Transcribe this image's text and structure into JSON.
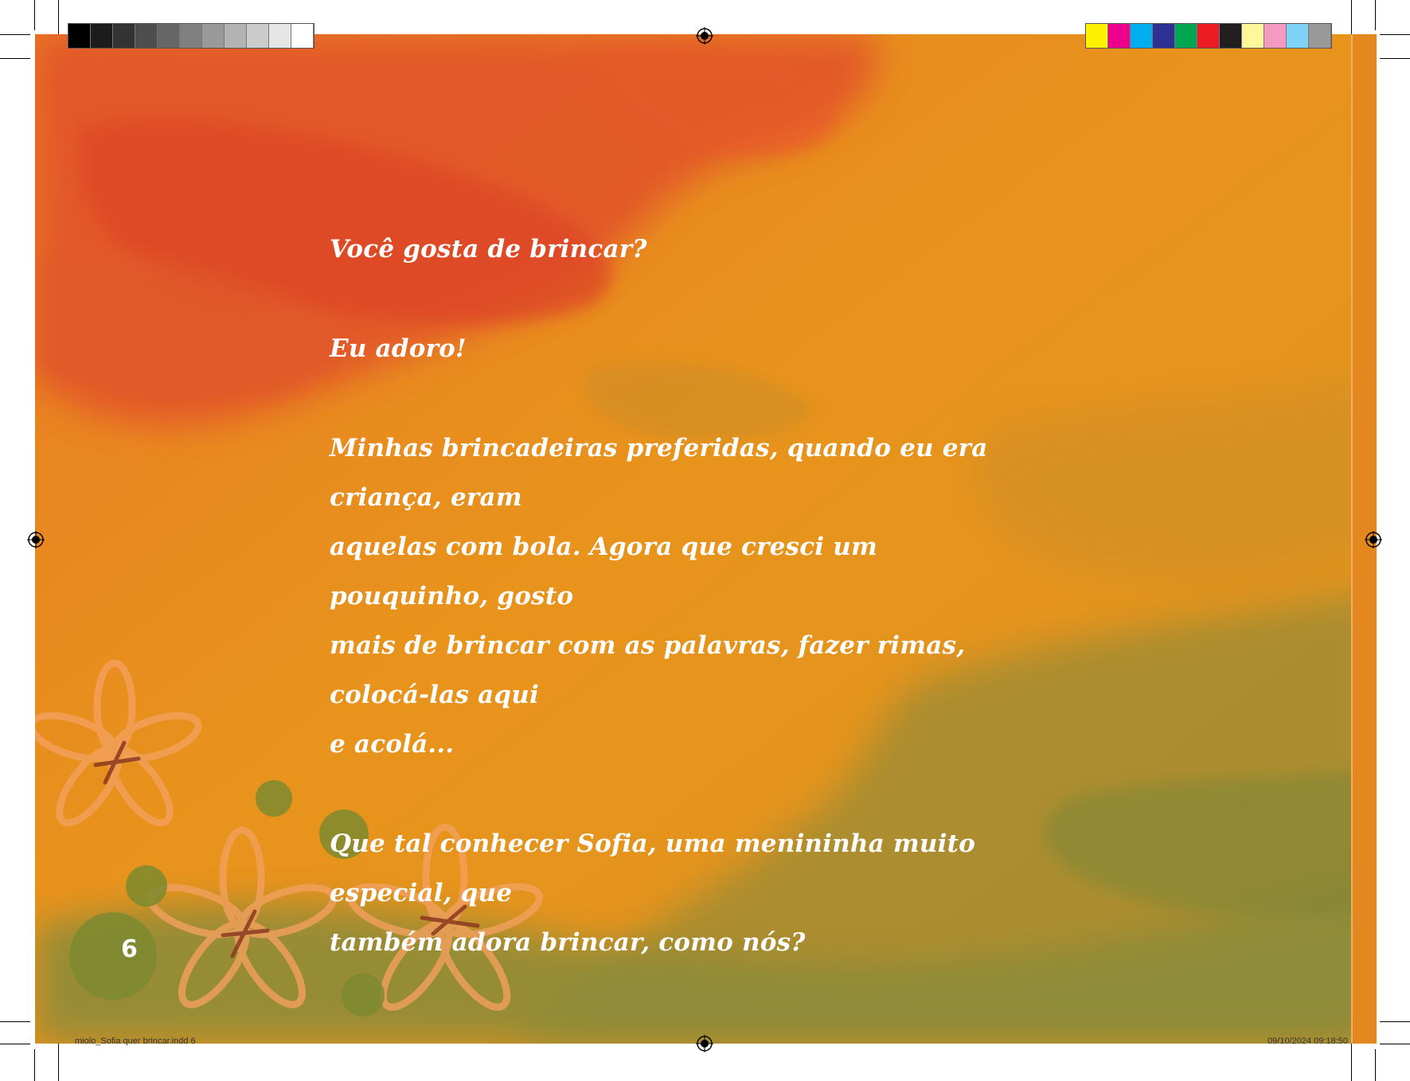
{
  "document": {
    "paragraphs": [
      {
        "lines": [
          "Você gosta de brincar?"
        ]
      },
      {
        "lines": [
          "Eu adoro!"
        ]
      },
      {
        "lines": [
          "Minhas brincadeiras preferidas, quando eu era criança, eram",
          "aquelas com bola. Agora que cresci um pouquinho, gosto",
          "mais de brincar com as palavras, fazer rimas, colocá-las aqui",
          "e acolá..."
        ]
      },
      {
        "lines": [
          "Que tal conhecer Sofia, uma menininha muito especial, que",
          "também adora brincar, como nós?"
        ]
      }
    ],
    "page_number": "6"
  },
  "print_marks": {
    "slug_left": "miolo_Sofia quer brincar.indd   6",
    "slug_right": "09/10/2024   09:18:50",
    "gray_swatches": [
      "#000000",
      "#1c1c1c",
      "#333333",
      "#4d4d4d",
      "#666666",
      "#808080",
      "#999999",
      "#b3b3b3",
      "#cccccc",
      "#e6e6e6",
      "#ffffff"
    ],
    "color_swatches": [
      "#fff200",
      "#ec008c",
      "#00aeef",
      "#2e3192",
      "#00a651",
      "#ed1c24",
      "#231f20",
      "#fff799",
      "#f49ac1",
      "#7fd3f7",
      "#999999"
    ]
  },
  "colors": {
    "background_orange": "#e6931d",
    "wash_red": "#e2512a",
    "wash_green": "#8a8b3a",
    "text": "#ffffff"
  }
}
